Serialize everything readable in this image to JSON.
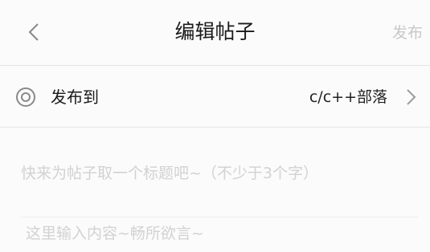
{
  "header": {
    "back_icon": "chevron-left-icon",
    "title": "编辑帖子",
    "publish_label": "发布"
  },
  "target": {
    "icon": "radio-target-icon",
    "label": "发布到",
    "value": "c/c++部落",
    "chevron_icon": "chevron-right-icon"
  },
  "form": {
    "title_placeholder": "快来为帖子取一个标题吧~（不少于3个字）",
    "title_value": "",
    "content_placeholder": "这里输入内容~畅所欲言~",
    "content_value": ""
  },
  "colors": {
    "background": "#fbfbfb",
    "placeholder": "#d2d2d2",
    "publish_disabled": "#c8c8c8",
    "divider": "#e3e3e3"
  }
}
